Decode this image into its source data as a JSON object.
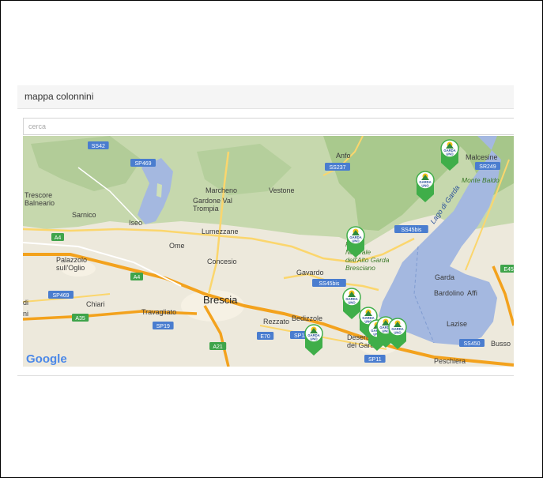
{
  "panel": {
    "title": "mappa colonnini"
  },
  "search": {
    "placeholder": "cerca"
  },
  "map": {
    "attribution": "Google",
    "colors": {
      "land": "#eae6d9",
      "urban": "#f6f2e8",
      "forest": "#b9d3a1",
      "mountain": "#9fc285",
      "water": "#a4b8e0",
      "motorway": "#f3a21d",
      "highway": "#fbd66d",
      "road_shield": "#4a7dcf",
      "motorway_shield": "#3fa44b",
      "marker": "#3fae49",
      "marker_badge": "#ffffff"
    },
    "places": [
      {
        "name": "Anfo",
        "style": "town"
      },
      {
        "name": "Malcesine",
        "style": "town"
      },
      {
        "name": "Trescore Balneario",
        "style": "town"
      },
      {
        "name": "Marcheno",
        "style": "town"
      },
      {
        "name": "Gardone Val Trompia",
        "style": "town"
      },
      {
        "name": "Vestone",
        "style": "town"
      },
      {
        "name": "Sarnico",
        "style": "town"
      },
      {
        "name": "Iseo",
        "style": "town"
      },
      {
        "name": "Lumezzane",
        "style": "town"
      },
      {
        "name": "Ome",
        "style": "town"
      },
      {
        "name": "Concesio",
        "style": "town"
      },
      {
        "name": "Gavardo",
        "style": "town"
      },
      {
        "name": "Palazzolo sull'Oglio",
        "style": "town"
      },
      {
        "name": "Chiari",
        "style": "town"
      },
      {
        "name": "Travagliato",
        "style": "town"
      },
      {
        "name": "Brescia",
        "style": "city"
      },
      {
        "name": "Rezzato",
        "style": "town"
      },
      {
        "name": "Bedizzole",
        "style": "town"
      },
      {
        "name": "Desenzano del Garda",
        "style": "town"
      },
      {
        "name": "Peschiera",
        "style": "town"
      },
      {
        "name": "Garda",
        "style": "town"
      },
      {
        "name": "Bardolino",
        "style": "town"
      },
      {
        "name": "Affi",
        "style": "town"
      },
      {
        "name": "Lazise",
        "style": "town"
      },
      {
        "name": "Busso",
        "style": "town"
      },
      {
        "name": "di",
        "style": "town"
      },
      {
        "name": "ni",
        "style": "town"
      },
      {
        "name": "Monte Baldo",
        "style": "park"
      },
      {
        "name": "Parco Naturale dell'Alto Garda Bresciano",
        "style": "park"
      },
      {
        "name": "Lago di Garda",
        "style": "water"
      }
    ],
    "road_shields": [
      {
        "label": "SS42",
        "type": "state"
      },
      {
        "label": "SP469",
        "type": "state"
      },
      {
        "label": "SS237",
        "type": "state"
      },
      {
        "label": "SR249",
        "type": "state"
      },
      {
        "label": "A4",
        "type": "motorway"
      },
      {
        "label": "A4",
        "type": "motorway"
      },
      {
        "label": "SS45bis",
        "type": "state"
      },
      {
        "label": "SS45bis",
        "type": "state"
      },
      {
        "label": "SP469",
        "type": "state"
      },
      {
        "label": "A35",
        "type": "motorway"
      },
      {
        "label": "SP19",
        "type": "state"
      },
      {
        "label": "E70",
        "type": "state"
      },
      {
        "label": "SP11",
        "type": "state"
      },
      {
        "label": "A21",
        "type": "motorway"
      },
      {
        "label": "SP11",
        "type": "state"
      },
      {
        "label": "SS450",
        "type": "state"
      },
      {
        "label": "E45",
        "type": "motorway"
      }
    ],
    "markers": [
      {
        "id": 1,
        "badge": "GARDA UNO"
      },
      {
        "id": 2,
        "badge": "GARDA UNO"
      },
      {
        "id": 3,
        "badge": "GARDA UNO"
      },
      {
        "id": 4,
        "badge": "GARDA UNO"
      },
      {
        "id": 5,
        "badge": "GARDA UNO"
      },
      {
        "id": 6,
        "badge": "GARDA UNO"
      },
      {
        "id": 7,
        "badge": "GARDA UNO"
      },
      {
        "id": 8,
        "badge": "GARDA UNO"
      },
      {
        "id": 9,
        "badge": "GARDA UNO"
      }
    ]
  }
}
